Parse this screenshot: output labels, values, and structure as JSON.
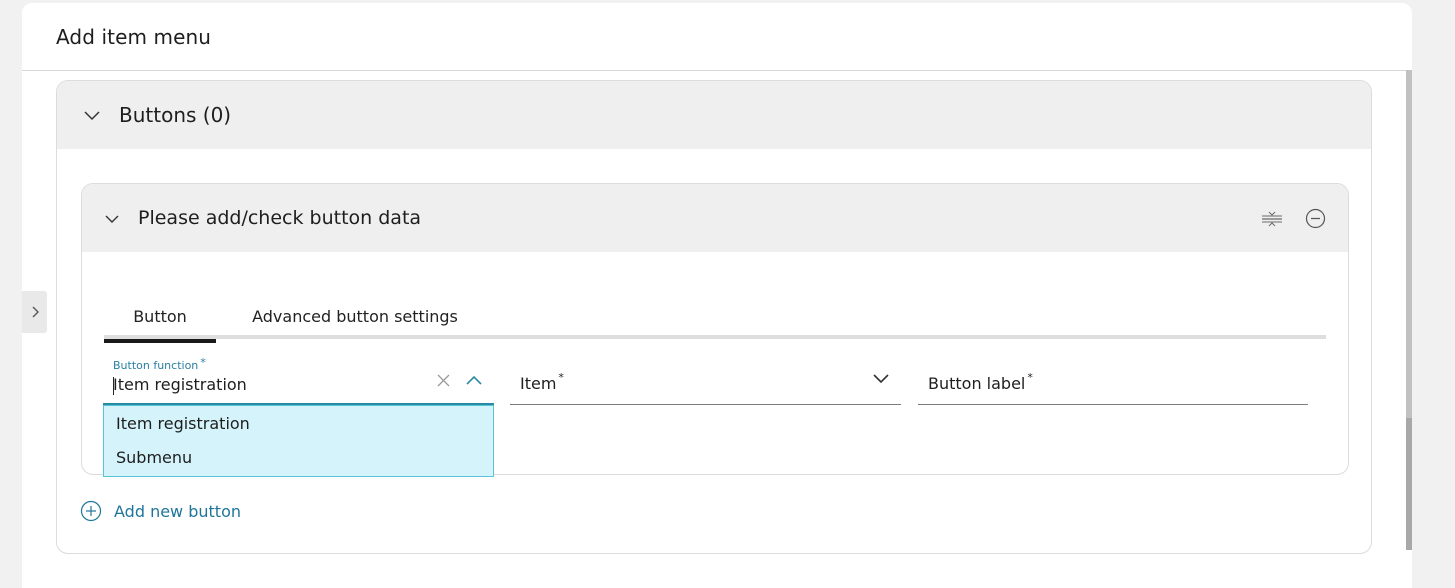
{
  "dialog": {
    "title": "Add item menu"
  },
  "outer": {
    "title": "Buttons (0)"
  },
  "inner": {
    "title": "Please add/check button data"
  },
  "tabs": [
    {
      "label": "Button",
      "active": true
    },
    {
      "label": "Advanced button settings",
      "active": false
    }
  ],
  "fields": {
    "function": {
      "label": "Button function",
      "required": "*",
      "value": "Item registration"
    },
    "item": {
      "label": "Item",
      "required": "*"
    },
    "button_label": {
      "label": "Button label",
      "required": "*"
    }
  },
  "dropdown": {
    "options": [
      "Item registration",
      "Submenu"
    ]
  },
  "add_button": {
    "label": "Add new button"
  },
  "colors": {
    "accent": "#20769a",
    "dropdown_bg": "#d5f3fa",
    "panel_head": "#efefef"
  },
  "icons": {
    "chevron": "chevron-down-icon",
    "collapse_all": "collapse-lines-icon",
    "remove": "minus-circle-icon",
    "clear": "close-icon",
    "add": "plus-circle-icon",
    "side": "chevron-right-icon"
  }
}
